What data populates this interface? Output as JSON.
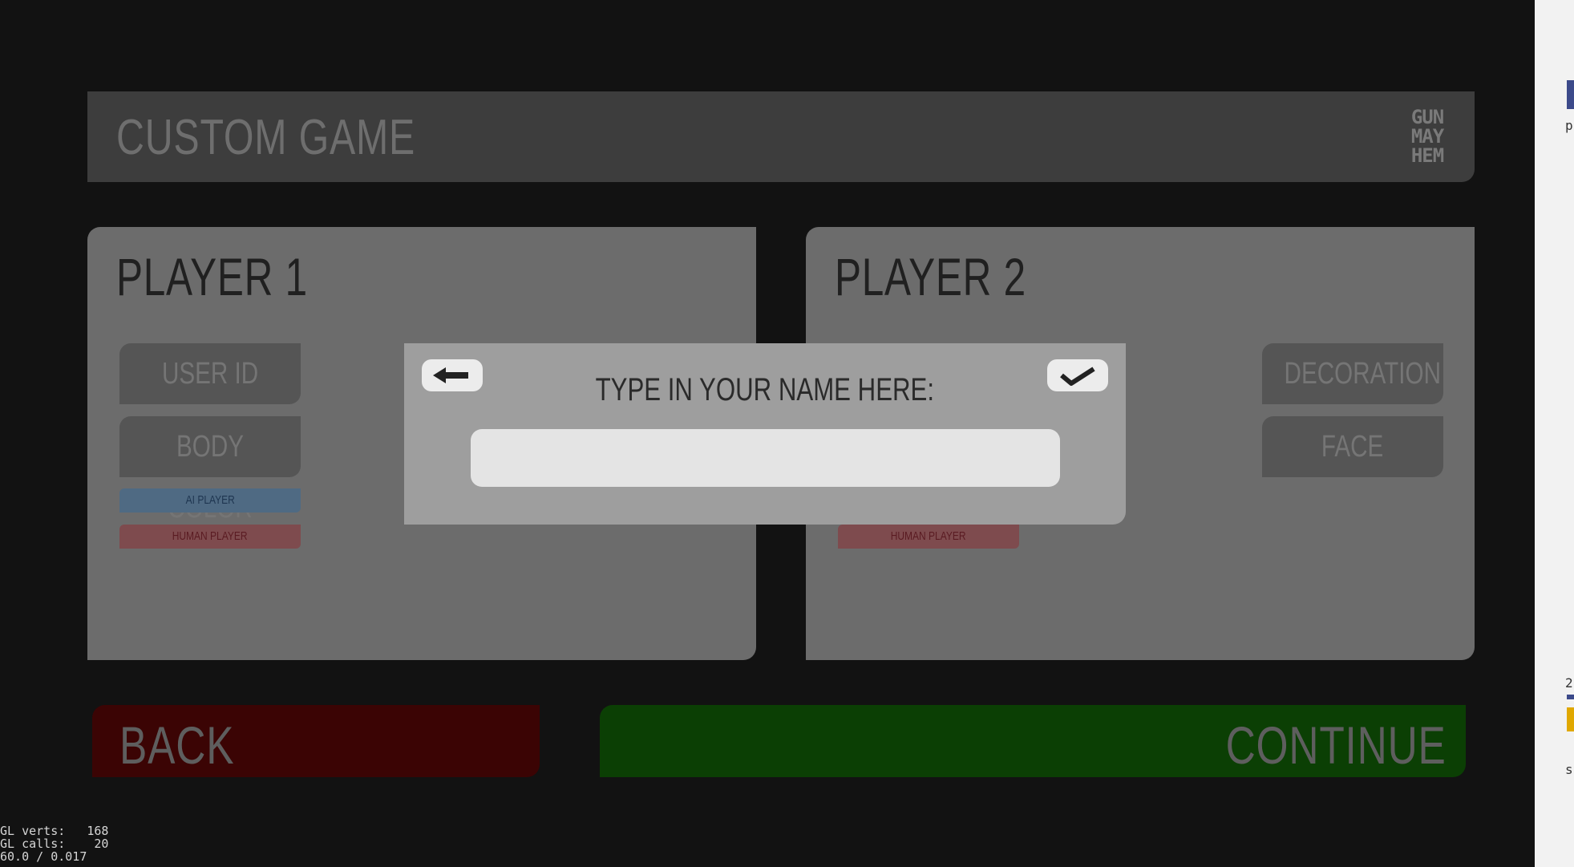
{
  "header": {
    "title": "CUSTOM GAME",
    "logo_lines": [
      "GUN",
      "MAY",
      "HEM"
    ]
  },
  "player1": {
    "title": "PLAYER 1",
    "buttons": [
      "USER ID",
      "BODY COLOR"
    ],
    "pills": {
      "ai": "AI PLAYER",
      "human": "HUMAN PLAYER"
    }
  },
  "player2": {
    "title": "PLAYER 2",
    "buttons": [
      "DECORATION",
      "FACE"
    ],
    "pills": {
      "human": "HUMAN PLAYER"
    }
  },
  "footer": {
    "back_label": "BACK",
    "continue_label": "CONTINUE"
  },
  "modal": {
    "title": "TYPE IN YOUR NAME HERE:",
    "input_value": ""
  },
  "debug": {
    "line1": "GL verts:   168",
    "line2": "GL calls:    20",
    "line3": "60.0 / 0.017"
  },
  "host_fragments": [
    "p",
    "2",
    "s"
  ],
  "colors": {
    "back": "#3b0404",
    "continue": "#0b3f04",
    "modal": "#9e9e9e",
    "panel": "#6c6c6c"
  }
}
